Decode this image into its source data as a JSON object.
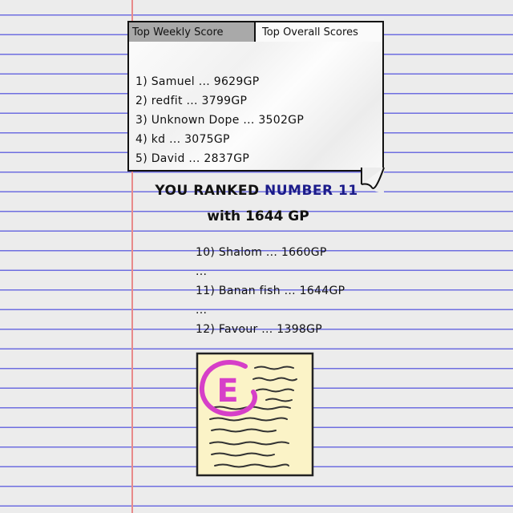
{
  "tabs": {
    "weekly": "Top Weekly Score",
    "overall": "Top Overall Scores",
    "active": "weekly"
  },
  "top_scores": [
    "1) Samuel ... 9629GP",
    "2) redfit ... 3799GP",
    "3) Unknown Dope ... 3502GP",
    "4) kd ... 3075GP",
    "5) David ... 2837GP"
  ],
  "rank": {
    "prefix": "YOU RANKED",
    "highlight": "NUMBER 11",
    "with": "with",
    "points": "1644 GP"
  },
  "nearby": {
    "above": "10) Shalom ... 1660GP",
    "sep1": "...",
    "current": "11) Banan fish ... 1644GP",
    "sep2": "...",
    "below": "12) Favour ... 1398GP"
  },
  "badge": {
    "grade": "E",
    "grade_color": "#d63fc8",
    "note_color": "#fbf3c7"
  },
  "colors": {
    "rule_lines": "#6e6ee0",
    "margin_line": "#e88a8a",
    "highlight": "#1b1b8a"
  }
}
